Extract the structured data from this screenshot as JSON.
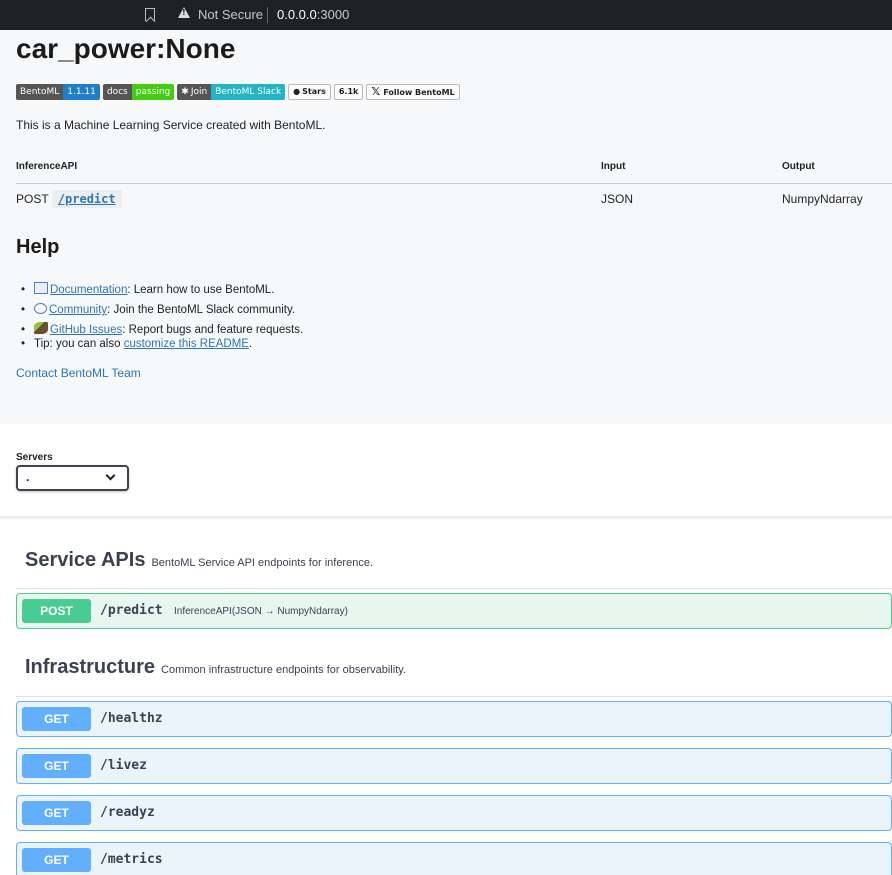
{
  "browser": {
    "security": "Not Secure",
    "url_host": "0.0.0.0",
    "url_port": ":3000"
  },
  "readme": {
    "title": "car_power:None",
    "badges": [
      {
        "left": "BentoML",
        "right": "1.1.11"
      },
      {
        "left": "docs",
        "right": "passing"
      },
      {
        "left": "Join",
        "right": "BentoML Slack"
      },
      {
        "left": "Stars",
        "right": "6.1k"
      },
      {
        "left": "Follow BentoML"
      }
    ],
    "description": "This is a Machine Learning Service created with BentoML.",
    "table": {
      "headers": [
        "InferenceAPI",
        "Input",
        "Output"
      ],
      "rows": [
        {
          "method": "POST",
          "path": "/predict",
          "input": "JSON",
          "output": "NumpyNdarray"
        }
      ]
    },
    "help": {
      "title": "Help",
      "items": [
        {
          "link": "Documentation",
          "text": ": Learn how to use BentoML."
        },
        {
          "link": "Community",
          "text": ": Join the BentoML Slack community."
        },
        {
          "link": "GitHub Issues",
          "text": ": Report bugs and feature requests."
        },
        {
          "prefix": "Tip: you can also ",
          "link": "customize this README",
          "suffix": "."
        }
      ]
    },
    "contact": "Contact BentoML Team"
  },
  "servers": {
    "label": "Servers",
    "selected": "."
  },
  "sections": {
    "service": {
      "title": "Service APIs",
      "subtitle": "BentoML Service API endpoints for inference.",
      "ops": [
        {
          "method": "POST",
          "path": "/predict",
          "desc": "InferenceAPI(JSON → NumpyNdarray)"
        }
      ]
    },
    "infra": {
      "title": "Infrastructure",
      "subtitle": "Common infrastructure endpoints for observability.",
      "ops": [
        {
          "method": "GET",
          "path": "/healthz"
        },
        {
          "method": "GET",
          "path": "/livez"
        },
        {
          "method": "GET",
          "path": "/readyz"
        },
        {
          "method": "GET",
          "path": "/metrics"
        }
      ]
    }
  },
  "colors": {
    "post": "#49cc90",
    "get": "#61affe",
    "link": "#2a76b8"
  }
}
